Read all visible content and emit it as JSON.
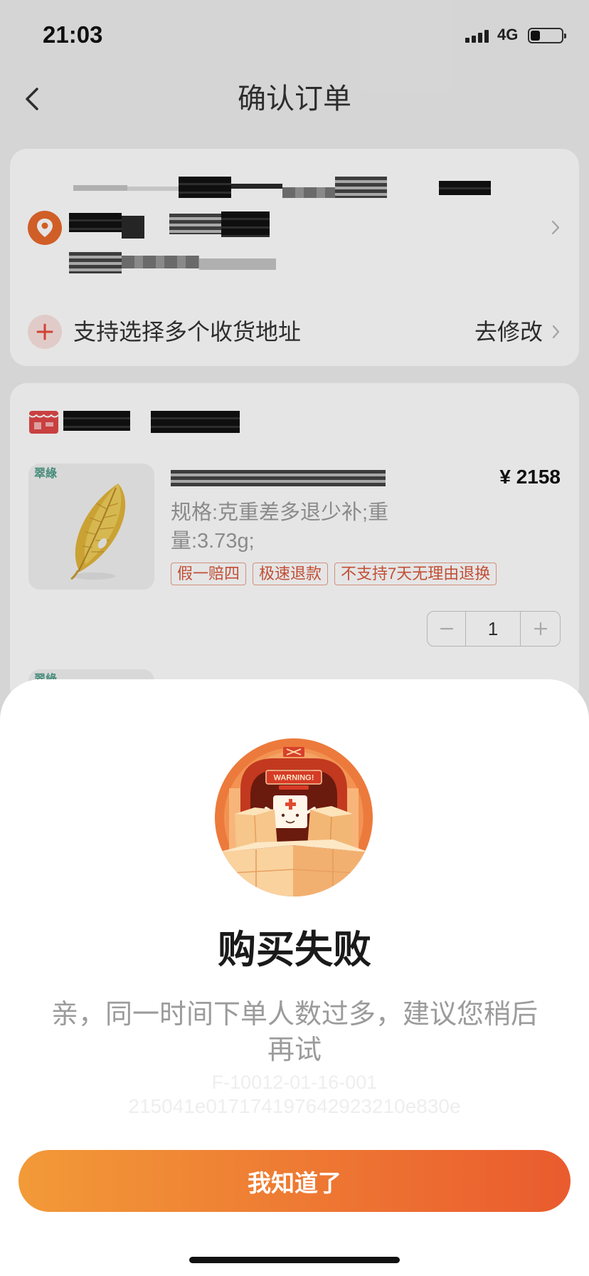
{
  "theme": {
    "accent": "#e8692c",
    "button_start": "#f29a38",
    "button_end": "#ea5b2e",
    "tag_color": "#d9583c"
  },
  "status_bar": {
    "time": "21:03",
    "network": "4G",
    "battery_level": 0.3,
    "signal_bars": 4
  },
  "nav": {
    "title": "确认订单",
    "back_icon": "chevron-left-icon"
  },
  "address": {
    "pin_icon": "location-pin-icon",
    "chevron_icon": "chevron-right-icon",
    "add_icon": "plus-circle-icon",
    "multi_address_label": "支持选择多个收货地址",
    "modify_label": "去修改"
  },
  "store": {
    "shop_icon": "shop-icon",
    "products": [
      {
        "image_label": "翠綠",
        "price": "¥ 2158",
        "spec": "规格:克重差多退少补;重量:3.73g;",
        "tags": [
          "假一赔四",
          "极速退款",
          "不支持7天无理由退换"
        ],
        "quantity": "1"
      },
      {
        "image_label": "翠綠"
      }
    ]
  },
  "failure_dialog": {
    "illustration_text": "WARNING!",
    "title": "购买失败",
    "message": "亲，同一时间下单人数过多，建议您稍后再试",
    "error_code": "F-10012-01-16-001",
    "trace_id": "215041e017174197642923210e830e",
    "button_label": "我知道了"
  }
}
